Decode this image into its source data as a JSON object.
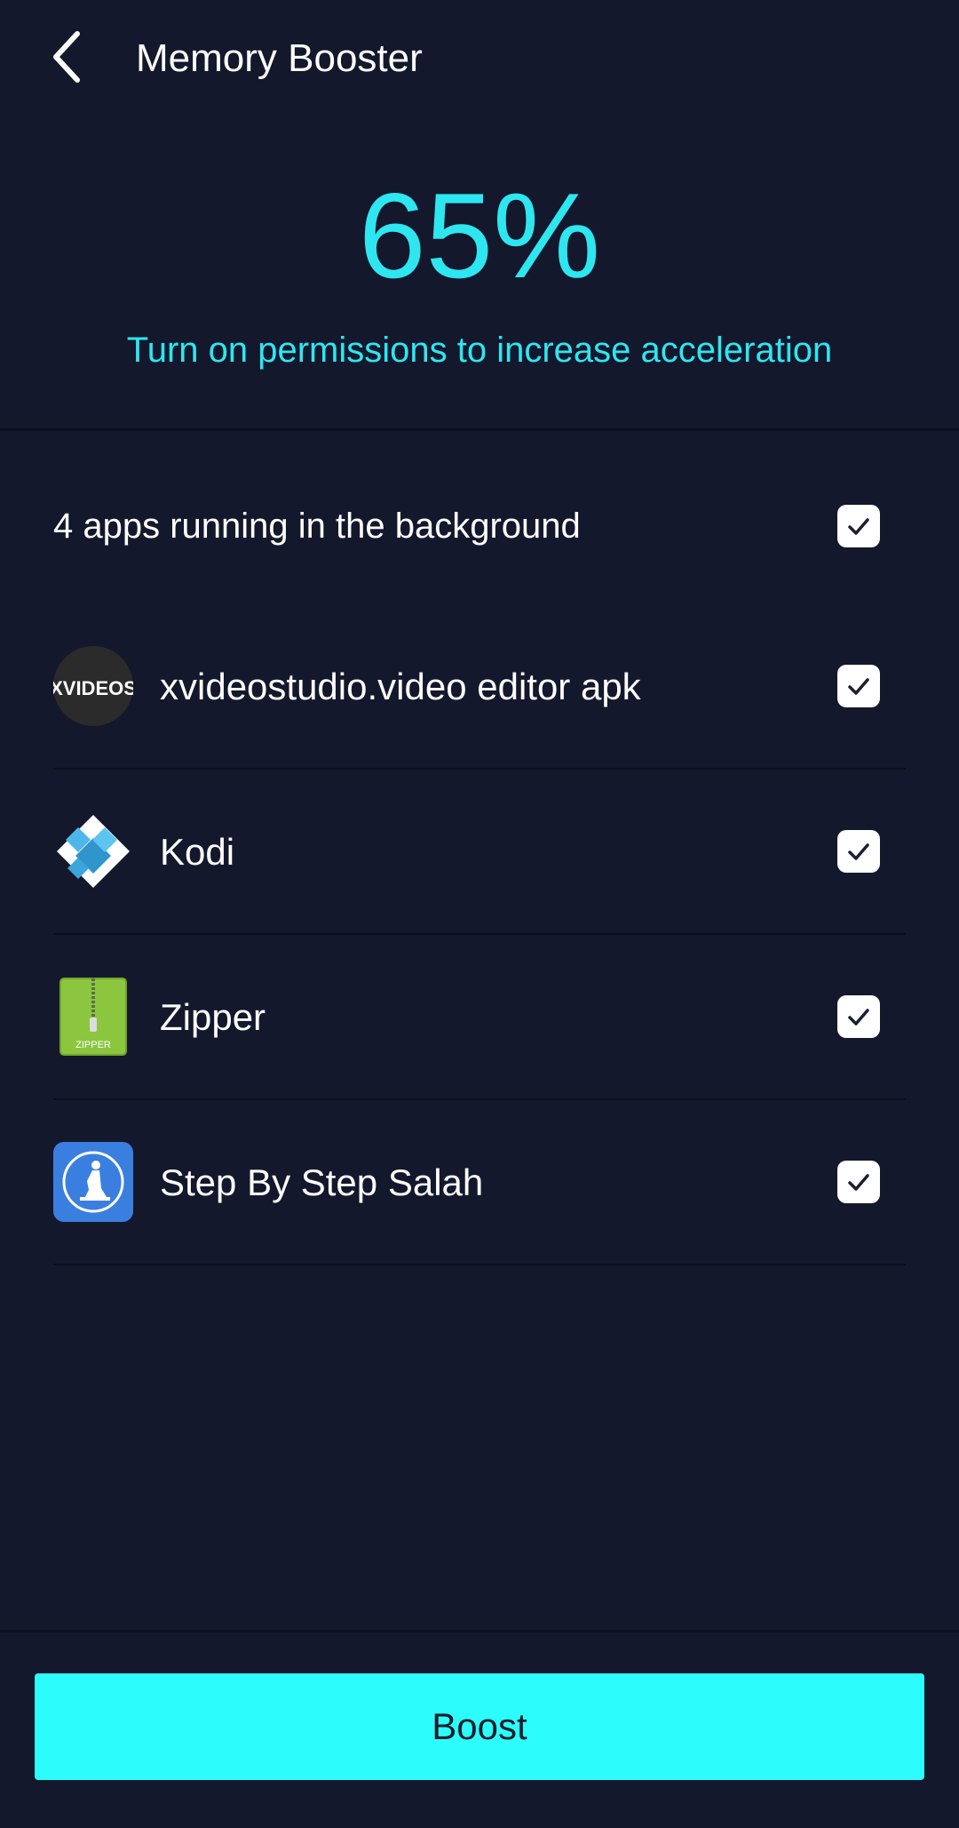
{
  "header": {
    "title": "Memory Booster"
  },
  "hero": {
    "percent": "65%",
    "hint": "Turn on permissions to increase acceleration"
  },
  "summary": {
    "label": "4 apps running in the background",
    "checked": true
  },
  "apps": [
    {
      "name": "xvideostudio.video editor apk",
      "icon": "xvideos-icon",
      "icon_text": "XVIDEOS",
      "checked": true
    },
    {
      "name": "Kodi",
      "icon": "kodi-icon",
      "checked": true
    },
    {
      "name": "Zipper",
      "icon": "zipper-icon",
      "icon_text": "ZIPPER",
      "checked": true
    },
    {
      "name": "Step By Step Salah",
      "icon": "salah-icon",
      "checked": true
    }
  ],
  "boost_button": {
    "label": "Boost"
  },
  "colors": {
    "background": "#14182c",
    "accent": "#2ee6f0",
    "button": "#2cfcfc"
  }
}
